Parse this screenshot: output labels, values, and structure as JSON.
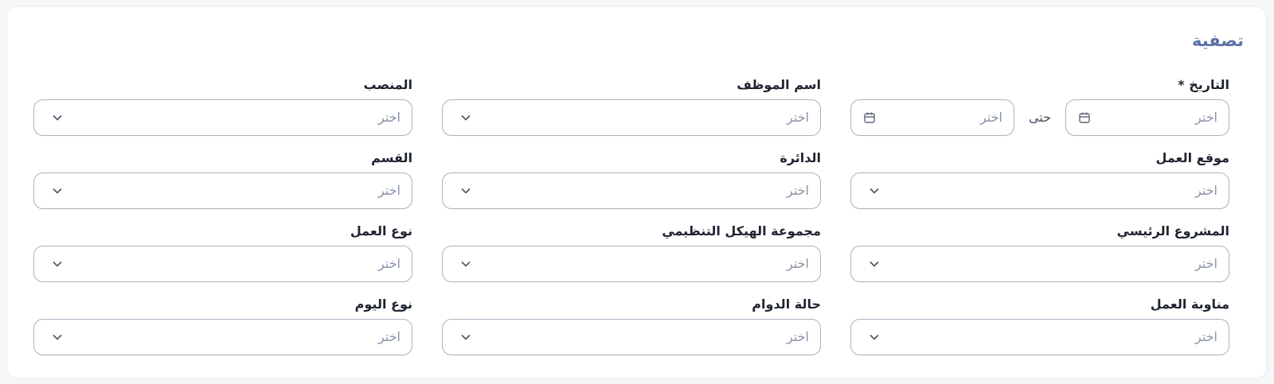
{
  "filter": {
    "title": "تصفية",
    "placeholder": "اختر",
    "date": {
      "label": "التاريخ *",
      "from_placeholder": "اختر",
      "until_label": "حتى",
      "to_placeholder": "اختر"
    },
    "fields": {
      "employee_name": "اسم الموظف",
      "position": "المنصب",
      "work_location": "موقع العمل",
      "circle": "الدائرة",
      "section": "القسم",
      "main_project": "المشروع الرئيسي",
      "org_group": "مجموعة الهيكل التنظيمي",
      "work_type": "نوع العمل",
      "work_shift": "مناوبة العمل",
      "attendance_status": "حالة الدوام",
      "day_type": "نوع اليوم"
    }
  }
}
